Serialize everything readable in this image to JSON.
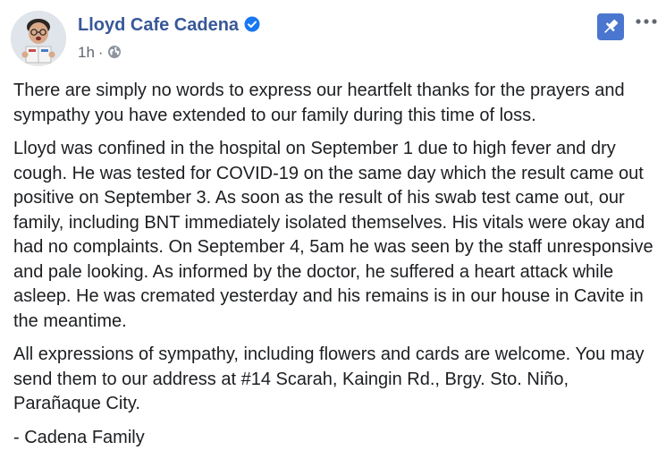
{
  "post": {
    "author": "Lloyd Cafe Cadena",
    "timestamp": "1h",
    "separator": "·",
    "privacy_icon": "globe-icon",
    "verified_icon": "verified-badge-icon",
    "pin_icon": "pushpin-icon",
    "more_icon": "more-options-icon",
    "colors": {
      "author": "#385898",
      "verified": "#1877f2",
      "pin_bg": "#4a76d0",
      "meta": "#606770",
      "text": "#1c1e21"
    },
    "paragraphs": [
      "There are simply no words to express our heartfelt thanks for the prayers and sympathy you have extended to our family during this time of loss.",
      "Lloyd was confined in the hospital on September 1 due to high fever and dry cough. He was tested for COVID-19 on the same day which the result came out positive on September 3. As soon as the result of his swab test came out, our family, including BNT immediately isolated themselves. His vitals were okay and had no complaints. On September 4, 5am he was seen by the staff unresponsive and pale looking. As informed by the doctor, he suffered a heart attack while asleep. He was cremated yesterday and his remains is in our house in Cavite in the meantime.",
      "All expressions of sympathy, including flowers and cards are welcome. You may send them to our address at #14 Scarah, Kaingin Rd., Brgy. Sto. Niño, Parañaque City.",
      "- Cadena Family"
    ]
  }
}
